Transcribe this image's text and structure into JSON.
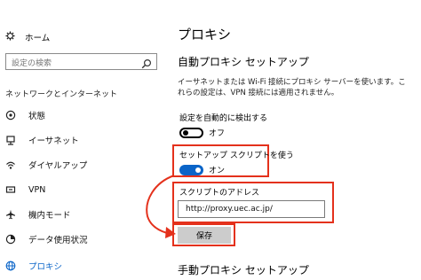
{
  "window": {
    "title": "設定"
  },
  "sidebar": {
    "home_label": "ホーム",
    "search_placeholder": "設定の検索",
    "section_label": "ネットワークとインターネット",
    "items": [
      {
        "label": "状態",
        "icon": "status-icon"
      },
      {
        "label": "イーサネット",
        "icon": "ethernet-icon"
      },
      {
        "label": "ダイヤルアップ",
        "icon": "dialup-icon"
      },
      {
        "label": "VPN",
        "icon": "vpn-icon"
      },
      {
        "label": "機内モード",
        "icon": "airplane-icon"
      },
      {
        "label": "データ使用状況",
        "icon": "data-usage-icon"
      },
      {
        "label": "プロキシ",
        "icon": "globe-icon",
        "active": true
      }
    ]
  },
  "main": {
    "title": "プロキシ",
    "auto_section_title": "自動プロキシ セットアップ",
    "description": "イーサネットまたは Wi-Fi 接続にプロキシ サーバーを使います。これらの設定は、VPN 接続には適用されません。",
    "auto_detect": {
      "label": "設定を自動的に検出する",
      "state": "オフ"
    },
    "use_script": {
      "label": "セットアップ スクリプトを使う",
      "state": "オン"
    },
    "script_address": {
      "label": "スクリプトのアドレス",
      "value": "http://proxy.uec.ac.jp/"
    },
    "save_label": "保存",
    "manual_section_title": "手動プロキシ セットアップ"
  },
  "colors": {
    "accent": "#0a64c8",
    "highlight": "#e4311c",
    "button": "#cccccc"
  }
}
